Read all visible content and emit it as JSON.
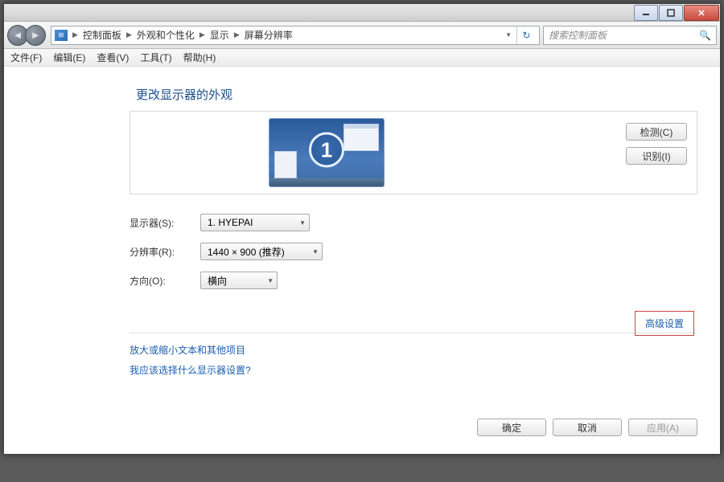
{
  "breadcrumb": {
    "root": "控制面板",
    "level1": "外观和个性化",
    "level2": "显示",
    "level3": "屏幕分辨率"
  },
  "search": {
    "placeholder": "搜索控制面板"
  },
  "menu": {
    "file": "文件(F)",
    "edit": "编辑(E)",
    "view": "查看(V)",
    "tools": "工具(T)",
    "help": "帮助(H)"
  },
  "heading": "更改显示器的外观",
  "monitor_number": "1",
  "buttons": {
    "detect": "检测(C)",
    "identify": "识别(I)",
    "ok": "确定",
    "cancel": "取消",
    "apply": "应用(A)"
  },
  "labels": {
    "display": "显示器(S):",
    "resolution": "分辨率(R):",
    "orientation": "方向(O):"
  },
  "values": {
    "display": "1. HYEPAI",
    "resolution": "1440 × 900 (推荐)",
    "orientation": "横向"
  },
  "links": {
    "advanced": "高级设置",
    "text_size": "放大或缩小文本和其他项目",
    "help_choose": "我应该选择什么显示器设置?"
  }
}
